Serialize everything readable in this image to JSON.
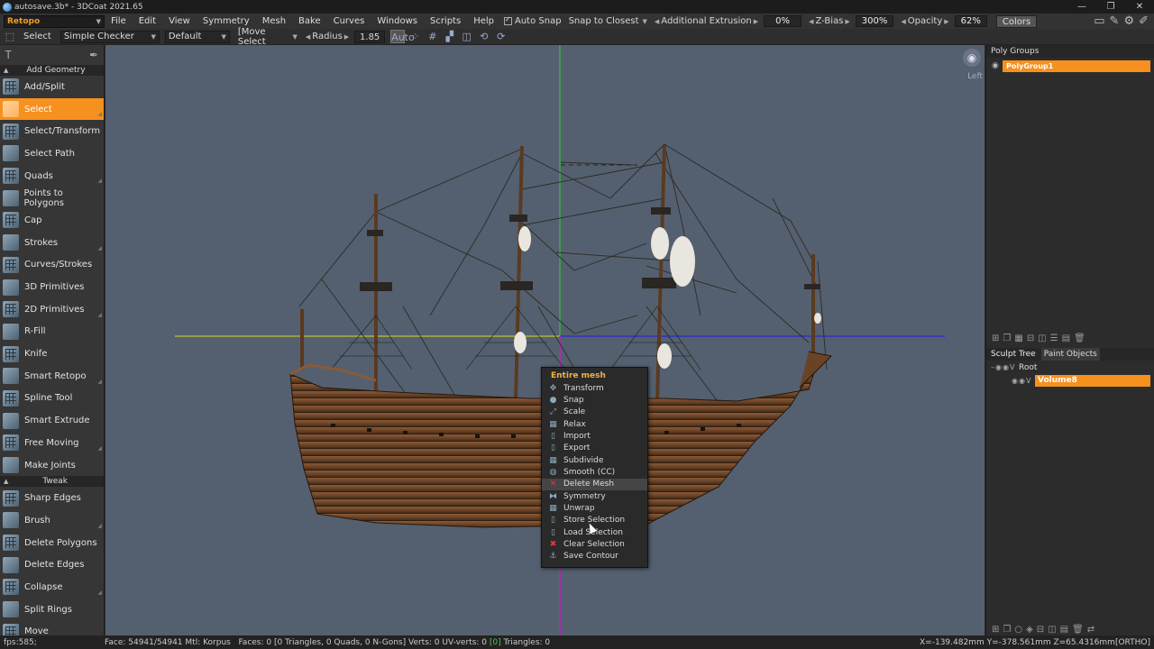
{
  "window": {
    "title": "autosave.3b* - 3DCoat 2021.65",
    "buttons": [
      "—",
      "❐",
      "✕"
    ]
  },
  "menubar": {
    "room": "Retopo",
    "items": [
      "File",
      "Edit",
      "View",
      "Symmetry",
      "Mesh",
      "Bake",
      "Curves",
      "Windows",
      "Scripts",
      "Help"
    ],
    "auto_snap": "Auto Snap",
    "snap_mode": "Snap to Closest",
    "additional_extrusion_label": "Additional Extrusion",
    "additional_extrusion_value": "0%",
    "zbias_label": "Z-Bias",
    "zbias_value": "300%",
    "opacity_label": "Opacity",
    "opacity_value": "62%",
    "colors": "Colors"
  },
  "toolbar": {
    "tool": "Select",
    "checker": "Simple Checker",
    "preset": "Default",
    "move_mode": "[Move Select",
    "radius_label": "Radius",
    "radius_value": "1.85",
    "auto": "Auto"
  },
  "left_panel": {
    "sections": [
      {
        "title": "Add Geometry",
        "items": [
          "Add/Split",
          "Select",
          "Select/Transform",
          "Select Path",
          "Quads",
          "Points to Polygons",
          "Cap",
          "Strokes",
          "Curves/Strokes",
          "3D Primitives",
          "2D Primitives",
          "R-Fill",
          "Knife",
          "Smart Retopo",
          "Spline Tool",
          "Smart Extrude",
          "Free Moving",
          "Make Joints"
        ]
      },
      {
        "title": "Tweak",
        "items": [
          "Sharp Edges",
          "Brush",
          "Delete Polygons",
          "Delete Edges",
          "Collapse",
          "Split Rings",
          "Move"
        ]
      }
    ],
    "active_item": "Select"
  },
  "viewport": {
    "view_label": "Left"
  },
  "context_menu": {
    "title": "Entire mesh",
    "items": [
      {
        "label": "Transform",
        "icon": "✥"
      },
      {
        "label": "Snap",
        "icon": "●"
      },
      {
        "label": "Scale",
        "icon": "⤢"
      },
      {
        "label": "Relax",
        "icon": "▦"
      },
      {
        "label": "Import",
        "icon": "▯"
      },
      {
        "label": "Export",
        "icon": "▯"
      },
      {
        "label": "Subdivide",
        "icon": "▦"
      },
      {
        "label": "Smooth (CC)",
        "icon": "◍"
      },
      {
        "label": "Delete Mesh",
        "icon": "✕"
      },
      {
        "label": "Symmetry",
        "icon": "⧓"
      },
      {
        "label": "Unwrap",
        "icon": "▦"
      },
      {
        "label": "Store Selection",
        "icon": "▯"
      },
      {
        "label": "Load Selection",
        "icon": "▯"
      },
      {
        "label": "Clear Selection",
        "icon": "✖"
      },
      {
        "label": "Save Contour",
        "icon": "⚓"
      }
    ],
    "hovered": "Delete Mesh"
  },
  "right_panel": {
    "poly_groups_title": "Poly Groups",
    "poly_group": "PolyGroup1",
    "tabs": [
      "Sculpt Tree",
      "Paint Objects"
    ],
    "tree_root": "Root",
    "tree_volume": "Volume8"
  },
  "statusbar": {
    "fps": "fps:585;",
    "face": "Face: 54941/54941 Mtl: Korpus",
    "faces": "Faces: 0 [0 Triangles, 0 Quads, 0 N-Gons] Verts: 0  UV-verts: 0",
    "uv_tag": "[0]",
    "triangles": "Triangles: 0",
    "coords": "X=-139.482mm  Y=-378.561mm  Z=65.4316mm[ORTHO]"
  }
}
